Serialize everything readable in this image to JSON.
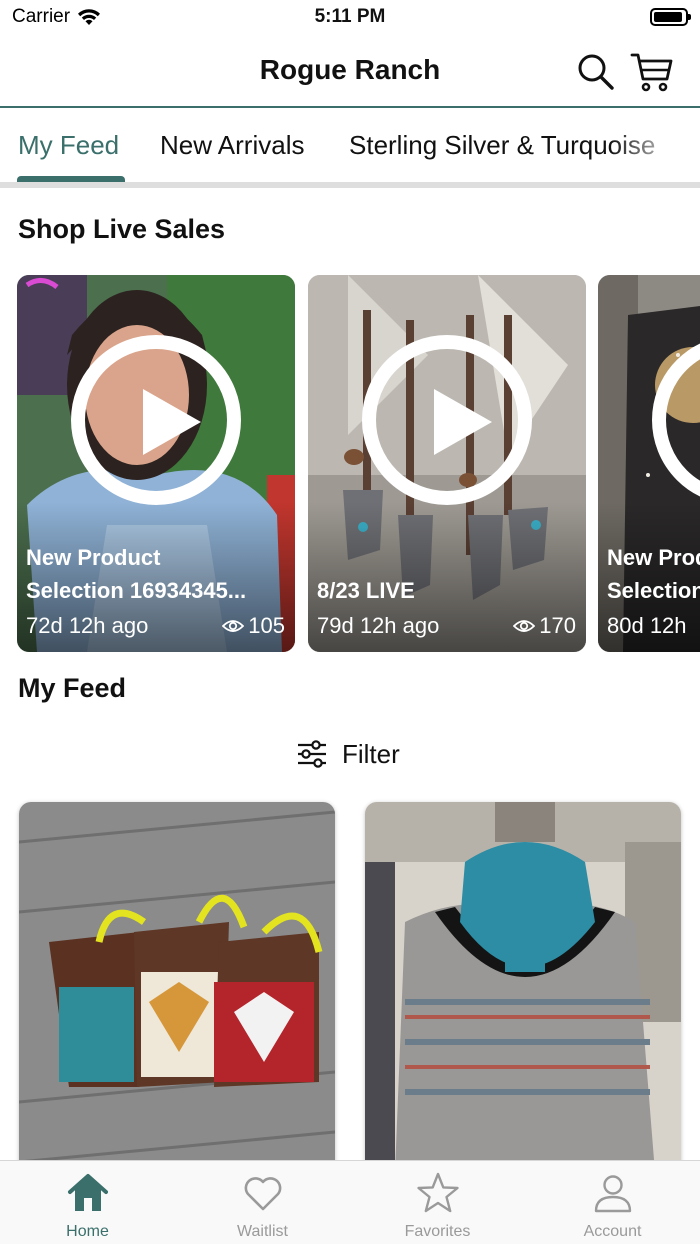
{
  "status_bar": {
    "carrier": "Carrier",
    "time": "5:11 PM"
  },
  "header": {
    "title": "Rogue Ranch",
    "search_icon": "search-icon",
    "cart_icon": "cart-icon"
  },
  "tabs": [
    {
      "label": "My Feed",
      "active": true
    },
    {
      "label": "New Arrivals",
      "active": false
    },
    {
      "label": "Sterling Silver & Turquoise",
      "active": false
    }
  ],
  "live_section": {
    "title": "Shop Live Sales",
    "cards": [
      {
        "title_line1": "New Product",
        "title_line2": "Selection 16934345...",
        "ago": "72d 12h ago",
        "views": "105"
      },
      {
        "title_line1": "8/23 LIVE",
        "title_line2": "",
        "ago": "79d 12h ago",
        "views": "170"
      },
      {
        "title_line1": "New Product",
        "title_line2": "Selection",
        "ago": "80d 12h",
        "views": ""
      }
    ]
  },
  "feed_section": {
    "title": "My Feed",
    "filter_label": "Filter"
  },
  "bottom_nav": [
    {
      "label": "Home",
      "icon": "home-icon",
      "active": true
    },
    {
      "label": "Waitlist",
      "icon": "heart-icon",
      "active": false
    },
    {
      "label": "Favorites",
      "icon": "star-icon",
      "active": false
    },
    {
      "label": "Account",
      "icon": "user-icon",
      "active": false
    }
  ],
  "colors": {
    "accent": "#3a6f6b",
    "inactive": "#9a9a9a"
  }
}
